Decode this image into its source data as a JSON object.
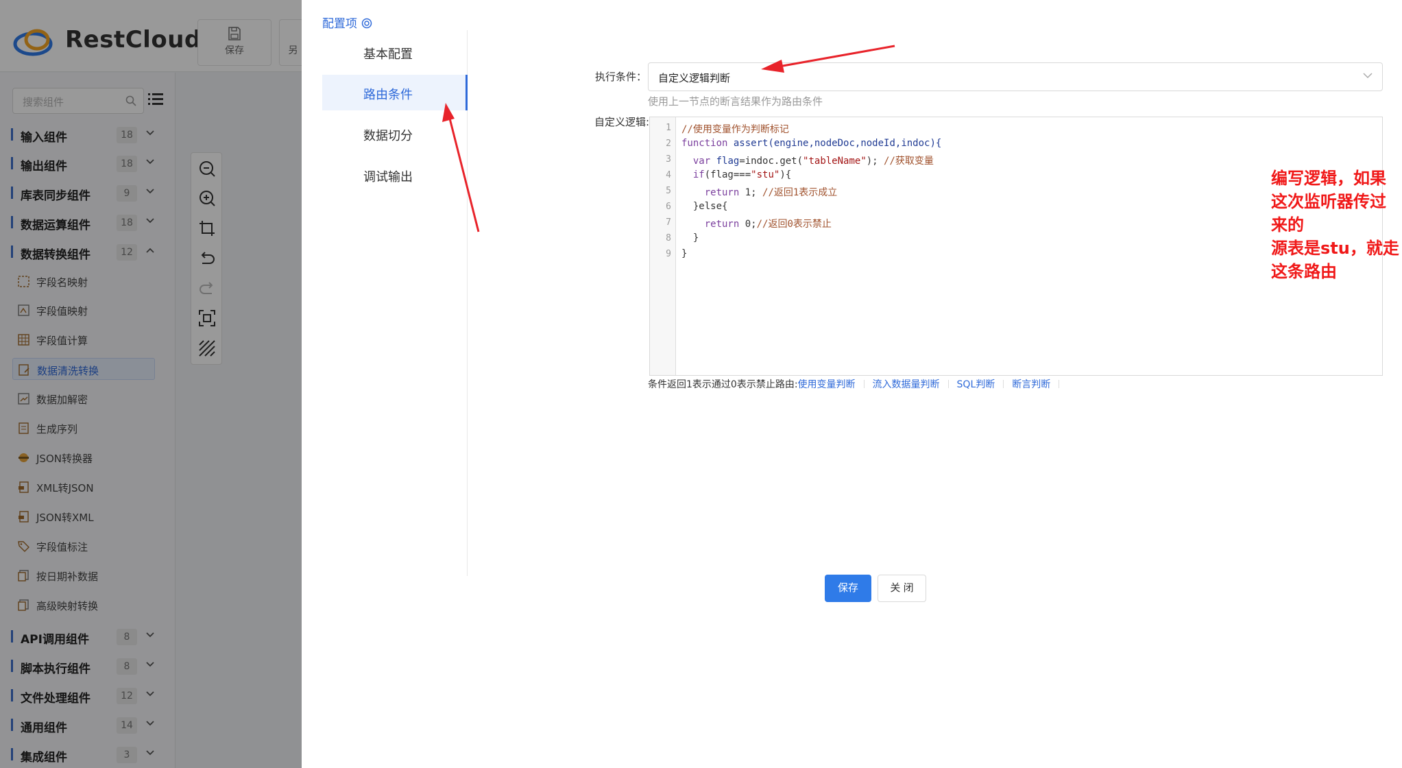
{
  "app": {
    "brand": "RestCloud",
    "toolbar": {
      "save_label": "保存",
      "partial_label": "另"
    },
    "search_placeholder": "搜索组件",
    "categories_top": [
      {
        "name": "输入组件",
        "count": "18"
      },
      {
        "name": "输出组件",
        "count": "18"
      },
      {
        "name": "库表同步组件",
        "count": "9"
      },
      {
        "name": "数据运算组件",
        "count": "18"
      },
      {
        "name": "数据转换组件",
        "count": "12"
      }
    ],
    "transform_items": [
      {
        "label": "字段名映射"
      },
      {
        "label": "字段值映射"
      },
      {
        "label": "字段值计算"
      },
      {
        "label": "数据清洗转换"
      },
      {
        "label": "数据加解密"
      },
      {
        "label": "生成序列"
      },
      {
        "label": "JSON转换器"
      },
      {
        "label": "XML转JSON"
      },
      {
        "label": "JSON转XML"
      },
      {
        "label": "字段值标注"
      },
      {
        "label": "按日期补数据"
      },
      {
        "label": "高级映射转换"
      }
    ],
    "categories_bottom": [
      {
        "name": "API调用组件",
        "count": "8"
      },
      {
        "name": "脚本执行组件",
        "count": "8"
      },
      {
        "name": "文件处理组件",
        "count": "12"
      },
      {
        "name": "通用组件",
        "count": "14"
      },
      {
        "name": "集成组件",
        "count": "3"
      }
    ]
  },
  "drawer": {
    "title": "配置项",
    "nav": [
      {
        "label": "基本配置"
      },
      {
        "label": "路由条件"
      },
      {
        "label": "数据切分"
      },
      {
        "label": "调试输出"
      }
    ],
    "exec_label": "执行条件：",
    "exec_value": "自定义逻辑判断",
    "exec_hint": "使用上一节点的断言结果作为路由条件",
    "logic_label": "自定义逻辑:",
    "code_lines": [
      "1",
      "2",
      "3",
      "4",
      "5",
      "6",
      "7",
      "8",
      "9"
    ],
    "code": {
      "l1": "//使用变量作为判断标记",
      "l2_kw": "function",
      "l2_fn": " assert",
      "l2_args": "(engine,nodeDoc,nodeId,indoc){",
      "l3_kw": "  var",
      "l3_id": " flag",
      "l3_mid": "=indoc.get(",
      "l3_str": "\"tableName\"",
      "l3_end": ");",
      "l3_cm": " //获取变量",
      "l4_kw": "  if",
      "l4_mid": "(flag===",
      "l4_str": "\"stu\"",
      "l4_end": "){",
      "l5_kw": "    return",
      "l5_val": " 1;",
      "l5_cm": " //返回1表示成立",
      "l6": "  }else{",
      "l7_kw": "    return",
      "l7_val": " 0;",
      "l7_cm": "//返回0表示禁止",
      "l8": "  }",
      "l9": "}"
    },
    "annotation_line1": "编写逻辑，如果这次监听器传过来的",
    "annotation_line2": "源表是stu，就走这条路由",
    "helper_text": "条件返回1表示通过0表示禁止路由:",
    "helper_links": [
      "使用变量判断",
      "流入数据量判断",
      "SQL判断",
      "断言判断"
    ],
    "save_label": "保存",
    "close_label": "关 闭"
  },
  "colors": {
    "accent": "#2f6ad9",
    "annotation": "#f01818",
    "arrow": "#e8232a"
  }
}
